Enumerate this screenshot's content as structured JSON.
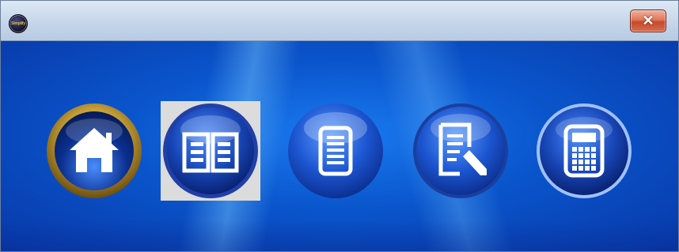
{
  "titlebar": {
    "app_icon_text": "Simplify",
    "close_glyph": "✕"
  },
  "toolbar": {
    "buttons": [
      {
        "name": "home-button",
        "icon": "home-icon",
        "selected": false
      },
      {
        "name": "book-button",
        "icon": "open-book-icon",
        "selected": true
      },
      {
        "name": "document-list-button",
        "icon": "document-list-icon",
        "selected": false
      },
      {
        "name": "edit-document-button",
        "icon": "edit-document-icon",
        "selected": false
      },
      {
        "name": "calculator-button",
        "icon": "calculator-icon",
        "selected": false
      }
    ]
  },
  "colors": {
    "background_blue": "#0a55cc",
    "orb_blue": "#1b5fd6",
    "home_ring_gold": "#c8a23a",
    "close_button_red": "#d0593a"
  }
}
